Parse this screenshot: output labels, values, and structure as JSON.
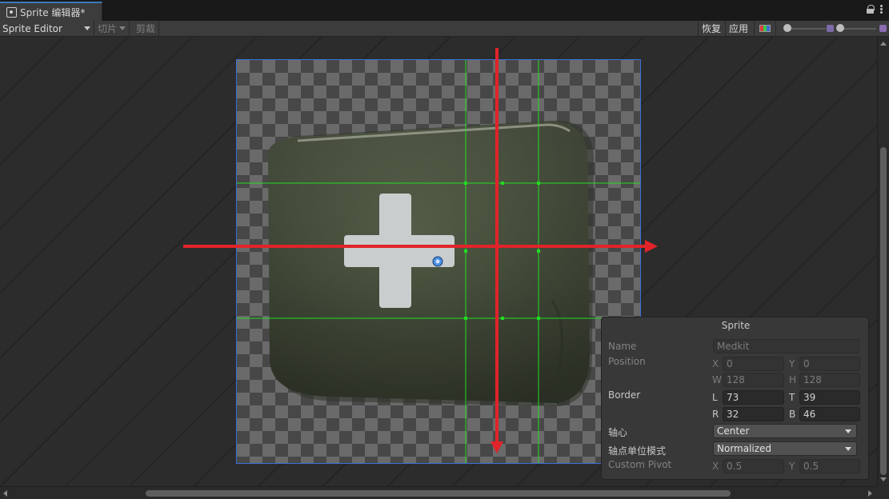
{
  "window": {
    "tab_title": "Sprite 编辑器*"
  },
  "toolbar": {
    "mode": "Sprite Editor",
    "slice_label": "切片",
    "trim_label": "剪裁",
    "revert_label": "恢复",
    "apply_label": "应用"
  },
  "sprite_panel": {
    "title": "Sprite",
    "name_label": "Name",
    "name_value": "Medkit",
    "position_label": "Position",
    "x_label": "X",
    "x_value": "0",
    "y_label": "Y",
    "y_value": "0",
    "w_label": "W",
    "w_value": "128",
    "h_label": "H",
    "h_value": "128",
    "border_label": "Border",
    "l_label": "L",
    "l_value": "73",
    "t_label": "T",
    "t_value": "39",
    "r_label": "R",
    "r_value": "32",
    "b_label": "B",
    "b_value": "46",
    "pivot_label": "轴心",
    "pivot_value": "Center",
    "pivot_unit_label": "轴点单位模式",
    "pivot_unit_value": "Normalized",
    "custom_pivot_label": "Custom Pivot",
    "cx_label": "X",
    "cx_value": "0.5",
    "cy_label": "Y",
    "cy_value": "0.5"
  },
  "colors": {
    "frame_border": "#3c6fd8",
    "slice_guides": "#22dd22",
    "annotation_arrows": "#e0242a",
    "pivot_handle": "#4a8fe0"
  }
}
